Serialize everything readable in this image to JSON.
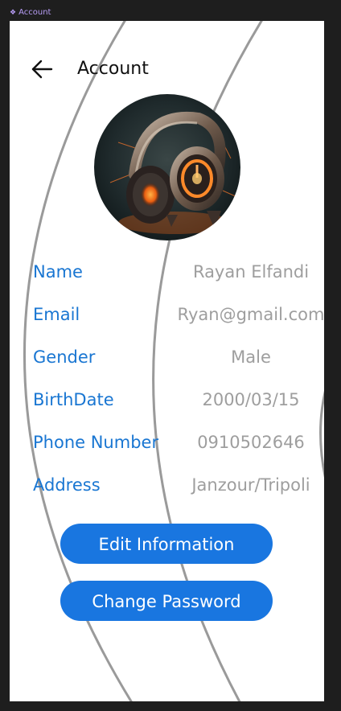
{
  "frame": {
    "label": "Account"
  },
  "header": {
    "title": "Account"
  },
  "profile": {
    "fields": [
      {
        "label": "Name",
        "value": "Rayan Elfandi"
      },
      {
        "label": "Email",
        "value": "Ryan@gmail.com"
      },
      {
        "label": "Gender",
        "value": "Male"
      },
      {
        "label": "BirthDate",
        "value": "2000/03/15"
      },
      {
        "label": "Phone Number",
        "value": "0910502646"
      },
      {
        "label": "Address",
        "value": "Janzour/Tripoli"
      }
    ]
  },
  "actions": {
    "edit_label": "Edit Information",
    "change_password_label": "Change Password"
  },
  "colors": {
    "accent": "#1976e0",
    "label": "#1976d2",
    "value": "#9e9e9e",
    "arc": "#9a9a9a"
  },
  "icons": {
    "back": "arrow-left-icon",
    "avatar": "headphones-artwork"
  }
}
